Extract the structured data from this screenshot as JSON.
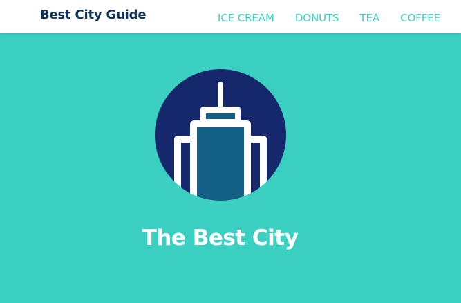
{
  "navbar": {
    "brand": "Best City Guide",
    "links": [
      {
        "label": "ICE CREAM"
      },
      {
        "label": "DONUTS"
      },
      {
        "label": "TEA"
      },
      {
        "label": "COFFEE"
      }
    ]
  },
  "hero": {
    "icon": "skyscraper-icon",
    "title": "The Best City"
  },
  "colors": {
    "background": "#3bcfc2",
    "navbar": "#ffffff",
    "brand_text": "#10325f",
    "nav_link": "#3bcfc2",
    "icon_circle": "#14286b",
    "icon_building": "#145f86",
    "title_text": "#ffffff"
  }
}
